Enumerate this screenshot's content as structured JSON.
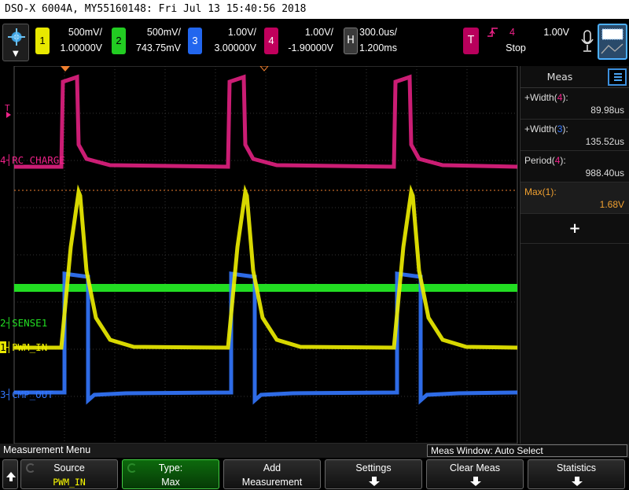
{
  "title": "DSO-X 6004A, MY55160148: Fri Jul 13 15:40:56 2018",
  "channels": [
    {
      "num": "1",
      "scale": "500mV/",
      "offset": "1.00000V",
      "color": "#f0f000",
      "label": "PWM_IN"
    },
    {
      "num": "2",
      "scale": "500mV/",
      "offset": "743.75mV",
      "color": "#22dd22",
      "label": "SENSE1"
    },
    {
      "num": "3",
      "scale": "1.00V/",
      "offset": "3.00000V",
      "color": "#3377ff",
      "label": "CMP_OUT"
    },
    {
      "num": "4",
      "scale": "1.00V/",
      "offset": "-1.90000V",
      "color": "#ee2288",
      "label": "RC_CHARGE"
    }
  ],
  "horizontal": {
    "tag": "H",
    "scale": "300.0us/",
    "delay": "1.200ms"
  },
  "trigger": {
    "tag": "T",
    "source": "4",
    "level": "1.00V",
    "state": "Stop"
  },
  "markers": {
    "trigger_side": "T",
    "ch4_tag": "4",
    "ch2_tag": "2",
    "ch1_tag": "1",
    "ch3_tag": "3"
  },
  "measurements": {
    "header": "Meas",
    "items": [
      {
        "name": "+Width",
        "ch": "4",
        "suffix": "):",
        "value": "89.98us",
        "ch_color": "#ee2288",
        "active": false
      },
      {
        "name": "+Width",
        "ch": "3",
        "suffix": "):",
        "value": "135.52us",
        "ch_color": "#3377ff",
        "active": false
      },
      {
        "name": "Period",
        "ch": "4",
        "suffix": "):",
        "value": "988.40us",
        "ch_color": "#ee2288",
        "active": false
      },
      {
        "name": "Max",
        "ch": "1",
        "suffix": "):",
        "value": "1.68V",
        "ch_color": "#f0a030",
        "active": true
      }
    ],
    "add": "+"
  },
  "menu": {
    "title": "Measurement Menu",
    "window": "Meas Window: Auto Select"
  },
  "softkeys": [
    {
      "top": "Source",
      "bottom": "PWM_IN"
    },
    {
      "top": "Type:",
      "bottom": "Max"
    },
    {
      "top": "Add",
      "bottom": "Measurement"
    },
    {
      "top": "Settings",
      "bottom": ""
    },
    {
      "top": "Clear Meas",
      "bottom": ""
    },
    {
      "top": "Statistics",
      "bottom": ""
    }
  ]
}
